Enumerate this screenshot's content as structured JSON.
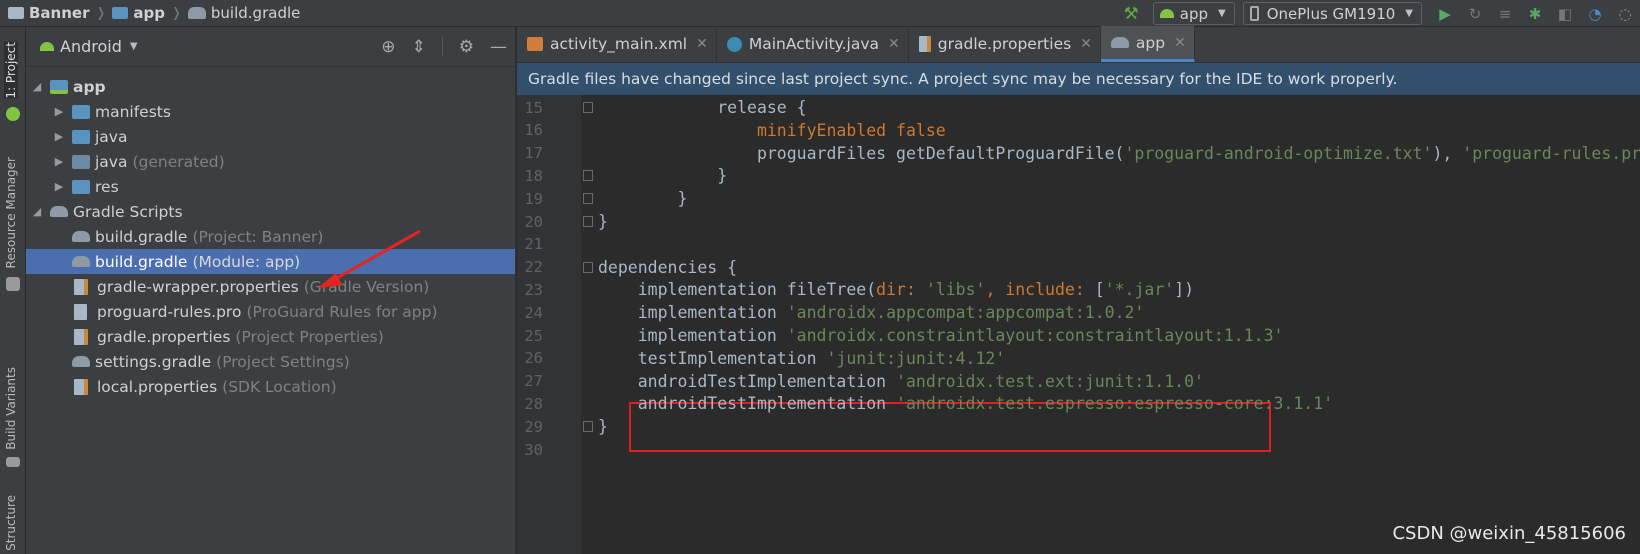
{
  "breadcrumb": {
    "project": "Banner",
    "module": "app",
    "file": "build.gradle"
  },
  "toolbar": {
    "run_config": "app",
    "device": "OnePlus GM1910"
  },
  "side_tabs": {
    "project": "1: Project",
    "resource_manager": "Resource Manager",
    "build_variants": "Build Variants",
    "structure": "Structure"
  },
  "project_panel": {
    "view": "Android",
    "tree": [
      {
        "label": "app",
        "hint": ""
      },
      {
        "label": "manifests",
        "hint": ""
      },
      {
        "label": "java",
        "hint": ""
      },
      {
        "label": "java",
        "hint": "(generated)"
      },
      {
        "label": "res",
        "hint": ""
      },
      {
        "label": "Gradle Scripts",
        "hint": ""
      },
      {
        "label": "build.gradle",
        "hint": "(Project: Banner)"
      },
      {
        "label": "build.gradle",
        "hint": "(Module: app)"
      },
      {
        "label": "gradle-wrapper.properties",
        "hint": "(Gradle Version)"
      },
      {
        "label": "proguard-rules.pro",
        "hint": "(ProGuard Rules for app)"
      },
      {
        "label": "gradle.properties",
        "hint": "(Project Properties)"
      },
      {
        "label": "settings.gradle",
        "hint": "(Project Settings)"
      },
      {
        "label": "local.properties",
        "hint": "(SDK Location)"
      }
    ]
  },
  "tabs": [
    "activity_main.xml",
    "MainActivity.java",
    "gradle.properties",
    "app"
  ],
  "banner": "Gradle files have changed since last project sync. A project sync may be necessary for the IDE to work properly.",
  "code": {
    "lines": [
      {
        "n": "15",
        "parts": [
          [
            "",
            "            release {"
          ]
        ]
      },
      {
        "n": "16",
        "parts": [
          [
            "kw",
            "                minifyEnabled "
          ],
          [
            "kw",
            "false"
          ]
        ]
      },
      {
        "n": "17",
        "parts": [
          [
            "",
            "                proguardFiles getDefaultProguardFile("
          ],
          [
            "str",
            "'proguard-android-optimize.txt'"
          ],
          [
            "",
            "), "
          ],
          [
            "str",
            "'proguard-rules.pro'"
          ]
        ]
      },
      {
        "n": "18",
        "parts": [
          [
            "",
            "            }"
          ]
        ]
      },
      {
        "n": "19",
        "parts": [
          [
            "",
            "        }"
          ]
        ]
      },
      {
        "n": "20",
        "parts": [
          [
            "",
            "}"
          ]
        ]
      },
      {
        "n": "21",
        "parts": [
          [
            "",
            ""
          ]
        ]
      },
      {
        "n": "22",
        "parts": [
          [
            "",
            "dependencies {"
          ]
        ]
      },
      {
        "n": "23",
        "parts": [
          [
            "",
            "    implementation fileTree("
          ],
          [
            "kw",
            "dir: "
          ],
          [
            "str",
            "'libs'"
          ],
          [
            "kw",
            ", include: "
          ],
          [
            "",
            "["
          ],
          [
            "str",
            "'*.jar'"
          ],
          [
            "",
            "])"
          ]
        ]
      },
      {
        "n": "24",
        "parts": [
          [
            "",
            "    implementation "
          ],
          [
            "str",
            "'androidx.appcompat:appcompat:1.0.2'"
          ]
        ]
      },
      {
        "n": "25",
        "parts": [
          [
            "",
            "    implementation "
          ],
          [
            "str",
            "'androidx.constraintlayout:constraintlayout:1.1.3'"
          ]
        ]
      },
      {
        "n": "26",
        "parts": [
          [
            "",
            "    testImplementation "
          ],
          [
            "str",
            "'junit:junit:4.12'"
          ]
        ]
      },
      {
        "n": "27",
        "parts": [
          [
            "",
            "    androidTestImplementation "
          ],
          [
            "str",
            "'androidx.test.ext:junit:1.1.0'"
          ]
        ]
      },
      {
        "n": "28",
        "parts": [
          [
            "",
            "    androidTestImplementation "
          ],
          [
            "str",
            "'androidx.test.espresso:espresso-core:3.1.1'"
          ]
        ]
      },
      {
        "n": "29",
        "parts": [
          [
            "",
            "}"
          ]
        ]
      },
      {
        "n": "30",
        "parts": [
          [
            "",
            ""
          ]
        ]
      }
    ]
  },
  "watermark": "CSDN @weixin_45815606"
}
